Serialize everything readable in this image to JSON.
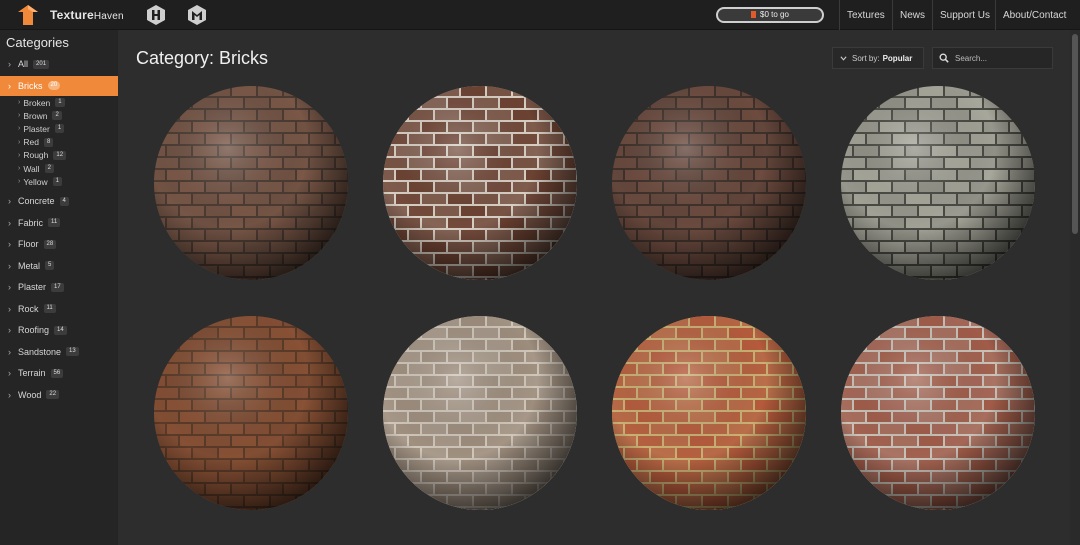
{
  "brand": {
    "name_part1": "Texture",
    "name_part2": "Haven"
  },
  "goal": {
    "label": "$0 to go"
  },
  "nav": [
    "Textures",
    "News",
    "Support Us",
    "About/Contact"
  ],
  "sidebar": {
    "title": "Categories",
    "categories": [
      {
        "label": "All",
        "count": "201"
      },
      {
        "label": "Bricks",
        "count": "20",
        "active": true
      },
      {
        "label": "Concrete",
        "count": "4"
      },
      {
        "label": "Fabric",
        "count": "11"
      },
      {
        "label": "Floor",
        "count": "28"
      },
      {
        "label": "Metal",
        "count": "5"
      },
      {
        "label": "Plaster",
        "count": "17"
      },
      {
        "label": "Rock",
        "count": "11"
      },
      {
        "label": "Roofing",
        "count": "14"
      },
      {
        "label": "Sandstone",
        "count": "13"
      },
      {
        "label": "Terrain",
        "count": "56"
      },
      {
        "label": "Wood",
        "count": "22"
      }
    ],
    "subcategories": [
      {
        "label": "Broken",
        "count": "1"
      },
      {
        "label": "Brown",
        "count": "2"
      },
      {
        "label": "Plaster",
        "count": "1"
      },
      {
        "label": "Red",
        "count": "8"
      },
      {
        "label": "Rough",
        "count": "12"
      },
      {
        "label": "Wall",
        "count": "2"
      },
      {
        "label": "Yellow",
        "count": "1"
      }
    ]
  },
  "main": {
    "title": "Category: Bricks",
    "sort_prefix": "Sort by:",
    "sort_value": "Popular",
    "search_placeholder": "Search..."
  },
  "textures": [
    {
      "base": "#6e5244",
      "mortar": "#4a3a32",
      "brick": "#7a5848"
    },
    {
      "base": "#5a3a2c",
      "mortar": "#d8cfc4",
      "brick": "#6a4030"
    },
    {
      "base": "#6a4a3e",
      "mortar": "#3e302a",
      "brick": "#6e4c40"
    },
    {
      "base": "#8a8a80",
      "mortar": "#4a4a44",
      "brick": "#a8a89c"
    },
    {
      "base": "#7a4a30",
      "mortar": "#5a3a28",
      "brick": "#8a5236"
    },
    {
      "base": "#8a7a6c",
      "mortar": "#d0c6ba",
      "brick": "#9c8c7c"
    },
    {
      "base": "#a8583c",
      "mortar": "#c9b074",
      "brick": "#b45a3c"
    },
    {
      "base": "#9a6a5a",
      "mortar": "#c8c2b8",
      "brick": "#a05a48"
    }
  ],
  "colors": {
    "accent": "#f08a3a",
    "bg": "#2d2d2d"
  }
}
